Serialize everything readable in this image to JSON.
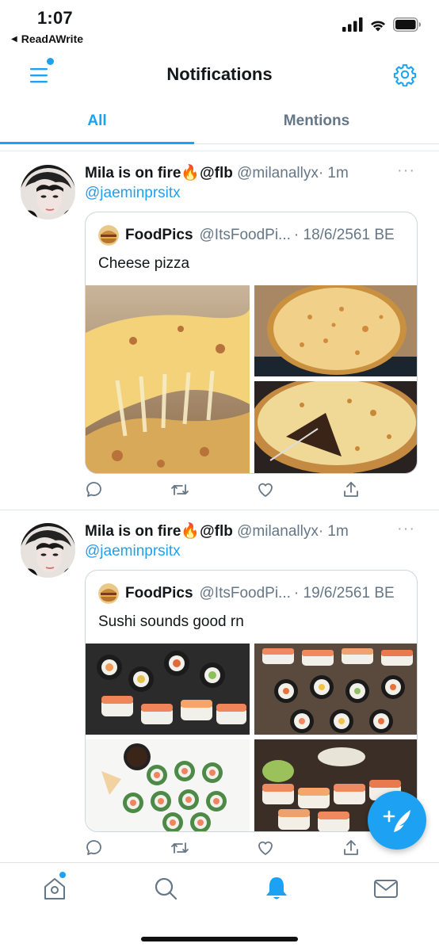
{
  "status": {
    "time": "1:07",
    "back_app": "ReadAWrite"
  },
  "nav": {
    "title": "Notifications"
  },
  "tabs": [
    {
      "label": "All",
      "active": true
    },
    {
      "label": "Mentions",
      "active": false
    }
  ],
  "tweets": [
    {
      "name": "Mila is on fire",
      "emoji": "🔥",
      "name_suffix": "@flb",
      "handle": "@milanallyx",
      "time": "· 1m",
      "mention": "@jaeminprsitx",
      "more": "···",
      "quote": {
        "name": "FoodPics",
        "handle": "@ItsFoodPi...",
        "date": "· 18/6/2561 BE",
        "text": "Cheese pizza"
      }
    },
    {
      "name": "Mila is on fire",
      "emoji": "🔥",
      "name_suffix": "@flb",
      "handle": "@milanallyx",
      "time": "· 1m",
      "mention": "@jaeminprsitx",
      "more": "···",
      "quote": {
        "name": "FoodPics",
        "handle": "@ItsFoodPi...",
        "date": "· 19/6/2561 BE",
        "text": "Sushi sounds good rn"
      }
    }
  ],
  "icons": [
    "menu-icon",
    "gear-icon",
    "reply-icon",
    "retweet-icon",
    "like-icon",
    "share-icon",
    "compose-icon",
    "home-icon",
    "search-icon",
    "bell-icon",
    "mail-icon"
  ],
  "colors": {
    "accent": "#1da1f2",
    "text": "#14171a",
    "secondary": "#657786",
    "border": "#ccd6dd"
  }
}
